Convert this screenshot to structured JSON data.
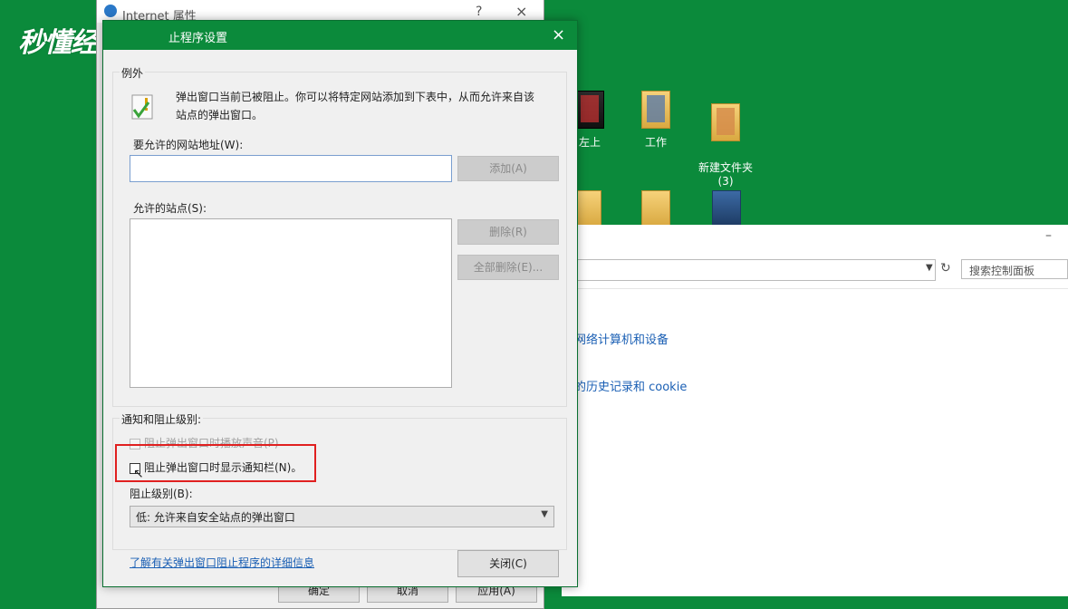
{
  "watermark": {
    "text": "秒懂经验"
  },
  "desktop": {
    "icons": [
      {
        "label": "左上"
      },
      {
        "label": "工作"
      },
      {
        "label": "新建文件夹\n(3)"
      }
    ]
  },
  "control_panel": {
    "min_label": "–",
    "search_placeholder": "搜索控制面板",
    "links": [
      {
        "label": "网络计算机和设备"
      },
      {
        "label": "的历史记录和 cookie"
      }
    ]
  },
  "internet_window": {
    "title": "Internet 属性",
    "help_label": "?",
    "close_label": "×",
    "buttons": {
      "ok": "确定",
      "cancel": "取消",
      "apply": "应用(A)"
    }
  },
  "dialog": {
    "title": "止程序设置",
    "close_label": "×",
    "exceptions": {
      "group_label": "例外",
      "description": "弹出窗口当前已被阻止。你可以将特定网站添加到下表中，从而允许来自该站点的弹出窗口。",
      "address_label": "要允许的网站地址(W):",
      "address_value": "",
      "add_button": "添加(A)",
      "allowed_label": "允许的站点(S):",
      "remove_button": "删除(R)",
      "remove_all_button": "全部删除(E)..."
    },
    "notify": {
      "group_label": "通知和阻止级别:",
      "play_sound_label": "阻止弹出窗口时播放声音(P)",
      "show_bar_label": "阻止弹出窗口时显示通知栏(N)。",
      "block_level_label": "阻止级别(B):",
      "block_level_value": "低: 允许来自安全站点的弹出窗口"
    },
    "help_link": "了解有关弹出窗口阻止程序的详细信息",
    "close_button": "关闭(C)"
  },
  "colors": {
    "desktop_bg": "#0b8a3b",
    "titlebar": "#0b8a3b",
    "highlight": "#e02020",
    "link": "#1a5fb4"
  }
}
